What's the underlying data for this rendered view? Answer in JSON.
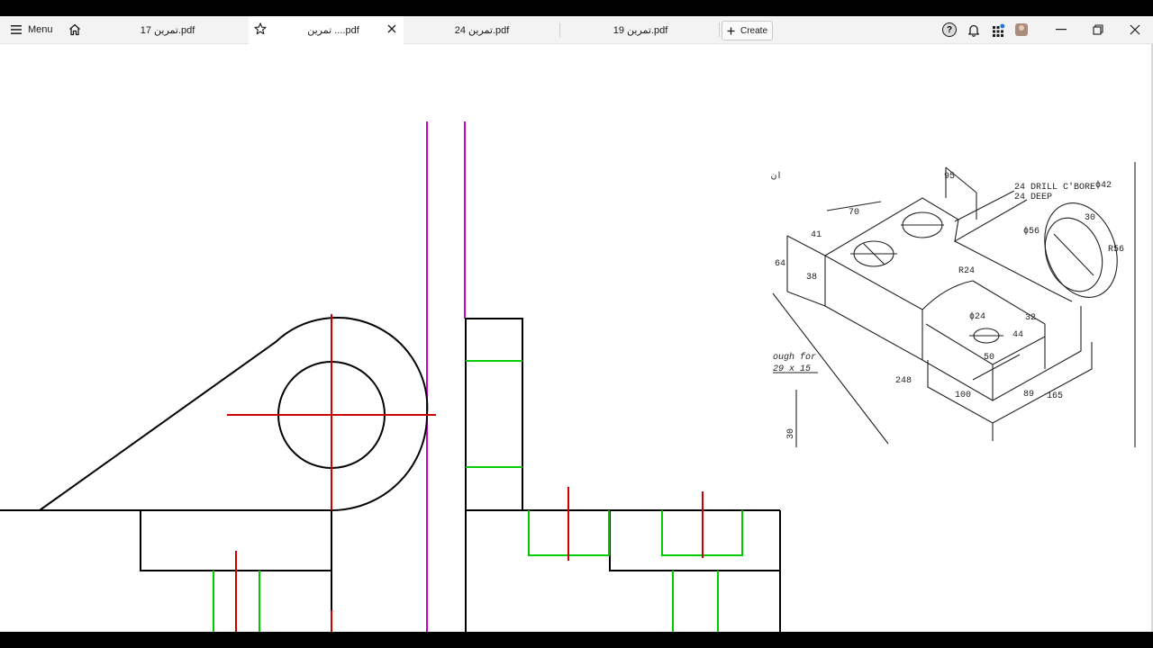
{
  "app": {
    "menu_label": "Menu"
  },
  "tabs": [
    {
      "label": "تمرین 17.pdf",
      "active": false
    },
    {
      "label": "تمرین ....pdf",
      "active": true
    },
    {
      "label": "تمرین 24.pdf",
      "active": false
    },
    {
      "label": "تمرین 19.pdf",
      "active": false
    }
  ],
  "toolbar": {
    "create_label": "Create",
    "help_label": "?"
  },
  "icons": {
    "menu": "hamburger-icon",
    "home": "home-icon",
    "star": "star-icon",
    "close_tab": "close-icon",
    "add": "plus-icon",
    "help": "help-icon",
    "notifications": "bell-icon",
    "apps": "apps-grid-icon",
    "profile": "avatar",
    "minimize": "minimize-icon",
    "restore": "restore-icon",
    "close_window": "close-icon"
  },
  "colors": {
    "drawing_line": "#000000",
    "center_line": "#cc0000",
    "hidden_line": "#00cc00",
    "projection_line": "#cc00cc",
    "notification_dot": "#1a73e8"
  },
  "isometric_labels": {
    "top_width": "95",
    "drill_note_1": "24 DRILL C'BORE",
    "drill_note_2": "24 DEEP",
    "cbore_dia": "ϕ42",
    "boss_length": "30",
    "dim_70": "70",
    "dim_41": "41",
    "hole_dia": "ϕ56",
    "radius_56": "R56",
    "height_64": "64",
    "dim_38": "38",
    "radius_24": "R24",
    "small_hole": "ϕ24",
    "dim_32": "32",
    "dim_44": "44",
    "dim_50": "50",
    "length_248": "248",
    "dim_100": "100",
    "dim_89": "89",
    "dim_165": "165",
    "side_note_1": "ough  for",
    "side_note_2": "29 x 15",
    "dim_30": "30",
    "corner_mark": "ان"
  }
}
